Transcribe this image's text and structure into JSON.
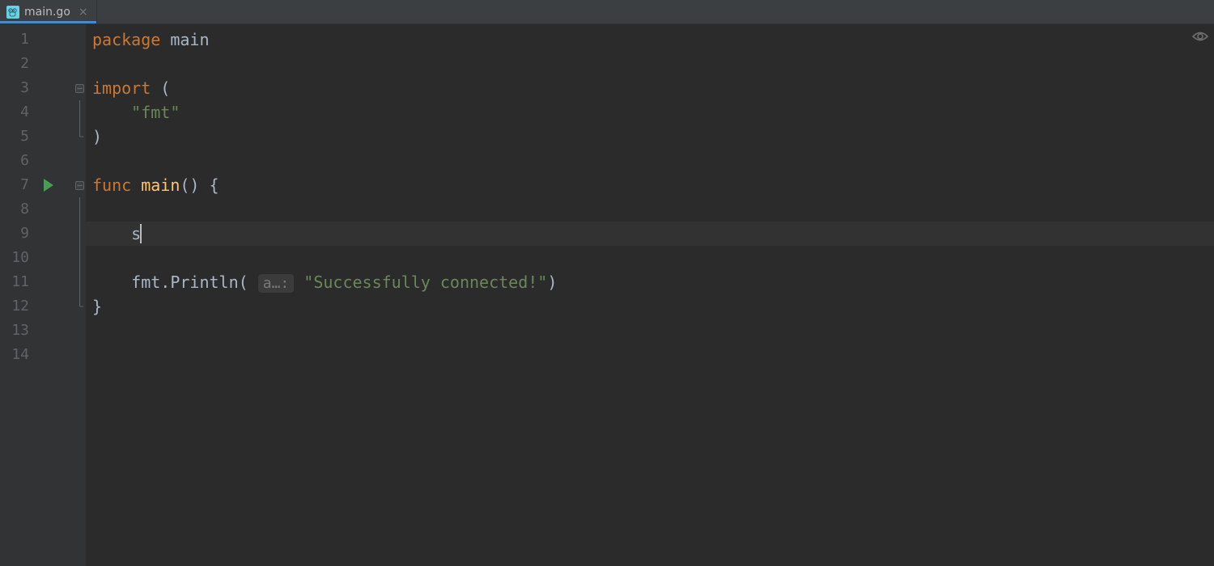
{
  "tab": {
    "filename": "main.go",
    "icon": "go-gopher-icon",
    "active": true
  },
  "gutter": {
    "line_numbers": [
      "1",
      "2",
      "3",
      "4",
      "5",
      "6",
      "7",
      "8",
      "9",
      "10",
      "11",
      "12",
      "13",
      "14"
    ],
    "run_marker_line": 7,
    "fold_markers": {
      "3": "fold-open",
      "5": "fold-close",
      "7": "fold-open",
      "12": "fold-close"
    }
  },
  "code": {
    "line1": {
      "kw_package": "package",
      "name_main": "main"
    },
    "line3": {
      "kw_import": "import",
      "paren_open": "("
    },
    "line4": {
      "indent": "    ",
      "str_fmt": "\"fmt\""
    },
    "line5": {
      "paren_close": ")"
    },
    "line7": {
      "kw_func": "func",
      "name_main_fn": "main",
      "parens": "()",
      "brace_open": "{"
    },
    "line9": {
      "indent": "    ",
      "typed": "s"
    },
    "line11": {
      "indent": "    ",
      "obj": "fmt",
      "dot": ".",
      "method": "Println",
      "open": "(",
      "param_hint": "a…:",
      "space": " ",
      "str_arg": "\"Successfully connected!\"",
      "close": ")"
    },
    "line12": {
      "brace_close": "}"
    }
  },
  "current_line": 9
}
